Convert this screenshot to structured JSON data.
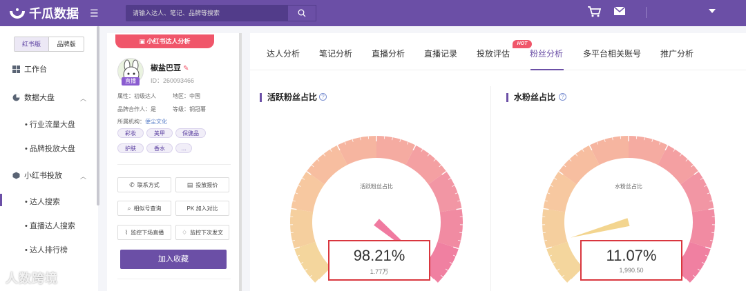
{
  "app": {
    "title": "千瓜数据"
  },
  "search": {
    "placeholder": "请输入达人、笔记、品牌等搜索"
  },
  "sidebar": {
    "seg": [
      "红书版",
      "品牌版"
    ],
    "items": [
      {
        "label": "工作台"
      },
      {
        "label": "数据大盘"
      },
      {
        "label": "行业流量大盘"
      },
      {
        "label": "品牌投放大盘"
      },
      {
        "label": "小红书投放"
      },
      {
        "label": "达人搜索"
      },
      {
        "label": "直播达人搜索"
      },
      {
        "label": "达人排行榜"
      }
    ]
  },
  "profile": {
    "ribbon": "小红书达人分析",
    "name": "椒盐巴豆",
    "id": "ID：260093466",
    "live": "直播",
    "attr_label": "属性：",
    "attr": "初级达人",
    "region_label": "地区：",
    "region": "中国",
    "brand_label": "品牌合作人：",
    "brand": "是",
    "level_label": "等级：",
    "level": "铜冠薯",
    "org_label": "所属机构：",
    "org": "便尘文化",
    "tags": [
      "彩妆",
      "美甲",
      "保健品",
      "护肤",
      "香水",
      "..."
    ],
    "actions": [
      "联系方式",
      "投放报价",
      "相似号查询",
      "PK 加入对比",
      "监控下场直播",
      "监控下次发文"
    ],
    "favorite": "加入收藏"
  },
  "watermark": "人数跨境",
  "tabs": [
    "达人分析",
    "笔记分析",
    "直播分析",
    "直播记录",
    "投放评估",
    "粉丝分析",
    "多平台相关账号",
    "推广分析"
  ],
  "active_tab": "粉丝分析",
  "hot_badge": "HOT",
  "gauges": [
    {
      "title": "活跃粉丝占比",
      "inner_label": "活跃粉丝占比",
      "value": "98.21%",
      "sub": "1.77万",
      "fraction": 0.9821,
      "needle_color": "#f07aa0"
    },
    {
      "title": "水粉丝占比",
      "inner_label": "水粉丝占比",
      "value": "11.07%",
      "sub": "1,990.50",
      "fraction": 0.1107,
      "needle_color": "#f3d58f"
    }
  ],
  "colors": {
    "brand": "#6b4fa6",
    "accent": "#f0566a",
    "highlight_box": "#d9363e"
  }
}
